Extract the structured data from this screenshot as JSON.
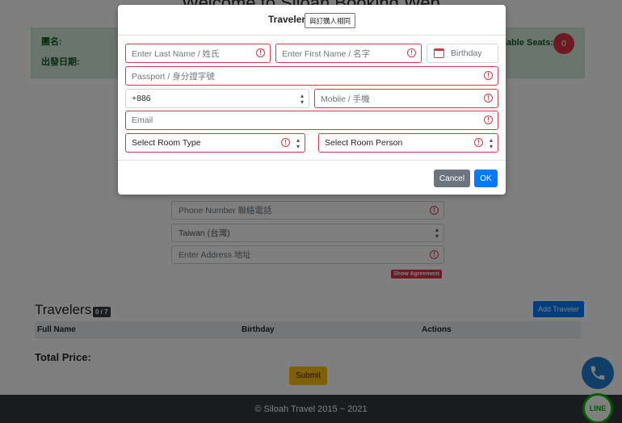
{
  "background": {
    "title": "Welcome to Siloah Booking Web",
    "tour": {
      "group_label": "團名:",
      "departure_label": "出發日期:",
      "seats_label": "Available Seats:",
      "seats_value": "0"
    },
    "form": {
      "phone_placeholder": "Phone Number 聯絡電話",
      "country_value": "Taiwan (台灣)",
      "address_placeholder": "Enter Address 地址",
      "agreement_label": "Show Agreement"
    },
    "travelers": {
      "title": "Travelers",
      "count": "0 / 7",
      "add_label": "Add Traveler",
      "columns": [
        "Full Name",
        "Birthday",
        "Actions"
      ]
    },
    "total_price_label": "Total Price:",
    "submit_label": "Submit",
    "footer_text": "© Siloah Travel 2015 ~ 2021",
    "line_label": "LINE"
  },
  "modal": {
    "title": "Traveler",
    "same_as_buyer_label": "與訂購人相同",
    "fields": {
      "last_name_placeholder": "Enter Last Name / 姓氏",
      "first_name_placeholder": "Enter First Name / 名字",
      "birthday_placeholder": "Birthday",
      "passport_placeholder": "Passport / 身分證字號",
      "country_code": "+886",
      "mobile_placeholder": "Mobile / 手機",
      "email_placeholder": "Email",
      "room_type_placeholder": "Select Room Type",
      "room_person_placeholder": "Select Room Person"
    },
    "cancel_label": "Cancel",
    "ok_label": "OK"
  },
  "colors": {
    "primary": "#007bff",
    "danger": "#dc3545",
    "secondary": "#6c757d",
    "warning": "#ffc107",
    "success_bg": "#d4edda"
  },
  "icons": {
    "error": "exclamation-circle-icon",
    "calendar": "calendar-icon",
    "phone": "phone-icon",
    "line": "line-app-icon"
  }
}
